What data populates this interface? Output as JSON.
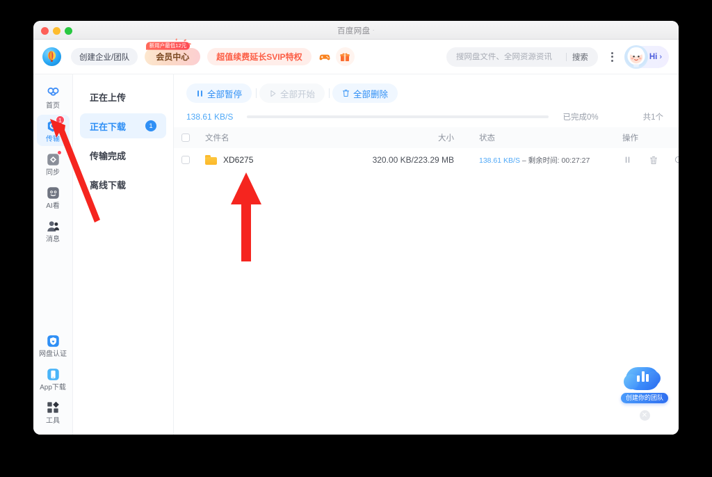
{
  "window": {
    "title": "百度网盘",
    "title_suffix": "·",
    "traffic_lights": [
      "close",
      "minimize",
      "zoom"
    ]
  },
  "header": {
    "logo_icon": "hot-air-balloon-logo",
    "create_team_label": "创建企业/团队",
    "vip_center_label": "会员中心",
    "vip_badge_label": "新用户最低12元",
    "svip_label": "超值续费延长SVIP特权",
    "game_icon": "game-controller-icon",
    "gift_icon": "gift-box-icon",
    "search": {
      "placeholder": "搜网盘文件、全网资源资讯",
      "value": "",
      "go_label": "搜索"
    },
    "more_icon": "more-vertical-icon",
    "user": {
      "avatar_icon": "astronaut-avatar",
      "greeting": "Hi",
      "chevron": "›"
    }
  },
  "nav_rail": {
    "items": [
      {
        "label": "首页",
        "icon": "home-cloud-icon",
        "active": false,
        "badge": "",
        "dot": false
      },
      {
        "label": "传输",
        "icon": "transfer-icon",
        "active": true,
        "badge": "1",
        "dot": false
      },
      {
        "label": "同步",
        "icon": "sync-icon",
        "active": false,
        "badge": "",
        "dot": true
      },
      {
        "label": "AI看",
        "icon": "ai-watch-icon",
        "active": false,
        "badge": "",
        "dot": false
      },
      {
        "label": "消息",
        "icon": "messages-icon",
        "active": false,
        "badge": "",
        "dot": false
      }
    ],
    "bottom_items": [
      {
        "label": "网盘认证",
        "icon": "shield-verify-icon"
      },
      {
        "label": "App下载",
        "icon": "mobile-phone-icon"
      },
      {
        "label": "工具",
        "icon": "tools-grid-icon"
      }
    ]
  },
  "tabs": [
    {
      "label": "正在上传",
      "active": false,
      "count": ""
    },
    {
      "label": "正在下载",
      "active": true,
      "count": "1"
    },
    {
      "label": "传输完成",
      "active": false,
      "count": ""
    },
    {
      "label": "离线下载",
      "active": false,
      "count": ""
    }
  ],
  "toolbar": {
    "pause_all_label": "全部暂停",
    "pause_all_icon": "pause-icon",
    "start_all_label": "全部开始",
    "start_all_icon": "play-icon",
    "delete_all_label": "全部删除",
    "delete_all_icon": "trash-icon"
  },
  "summary": {
    "speed": "138.61 KB/S",
    "progress_percent": 0,
    "completed_label": "已完成0%",
    "total_label": "共1个"
  },
  "table": {
    "columns": [
      "文件名",
      "大小",
      "状态",
      "操作"
    ],
    "rows": [
      {
        "name": "XD6275",
        "icon": "folder-icon",
        "size": "320.00 KB/223.29 MB",
        "progress_percent": 0.14,
        "state_speed": "138.61 KB/S",
        "state_rest": " – 剩余时间: 00:27:27",
        "ops": [
          "pause-icon",
          "trash-icon",
          "locate-search-icon"
        ]
      }
    ]
  },
  "promo": {
    "label": "创建你的团队",
    "art_icon": "cloud-chart-icon",
    "close_icon": "close-icon"
  },
  "annotations": {
    "arrow_color": "#f5251f",
    "arrow_sidebar_target": "传输",
    "arrow_file_target": "XD6275"
  }
}
